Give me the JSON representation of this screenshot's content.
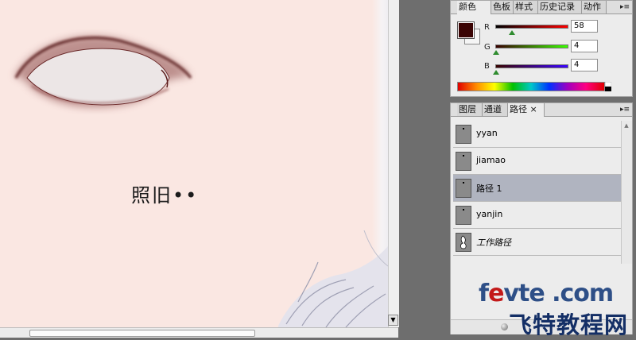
{
  "canvas": {
    "text": "照旧••"
  },
  "color_panel": {
    "tabs": [
      "颜色",
      "色板",
      "样式",
      "历史记录",
      "动作"
    ],
    "active_tab": "颜色",
    "foreground_color": "#3a0404",
    "background_color": "#f5f5f5",
    "sliders": [
      {
        "label": "R",
        "value": "58",
        "fraction": 0.227
      },
      {
        "label": "G",
        "value": "4",
        "fraction": 0.016
      },
      {
        "label": "B",
        "value": "4",
        "fraction": 0.016
      }
    ]
  },
  "paths_panel": {
    "tabs": [
      "图层",
      "通道",
      "路径"
    ],
    "active_tab": "路径",
    "close_label": "×",
    "items": [
      {
        "name": "yyan",
        "selected": false
      },
      {
        "name": "jiamao",
        "selected": false
      },
      {
        "name": "路径 1",
        "selected": true
      },
      {
        "name": "yanjin",
        "selected": false
      },
      {
        "name": "工作路径",
        "selected": false
      }
    ]
  },
  "watermark": {
    "line1_a": "f",
    "line1_e": "e",
    "line1_b": "vte .com",
    "line2": "飞特教程网"
  }
}
